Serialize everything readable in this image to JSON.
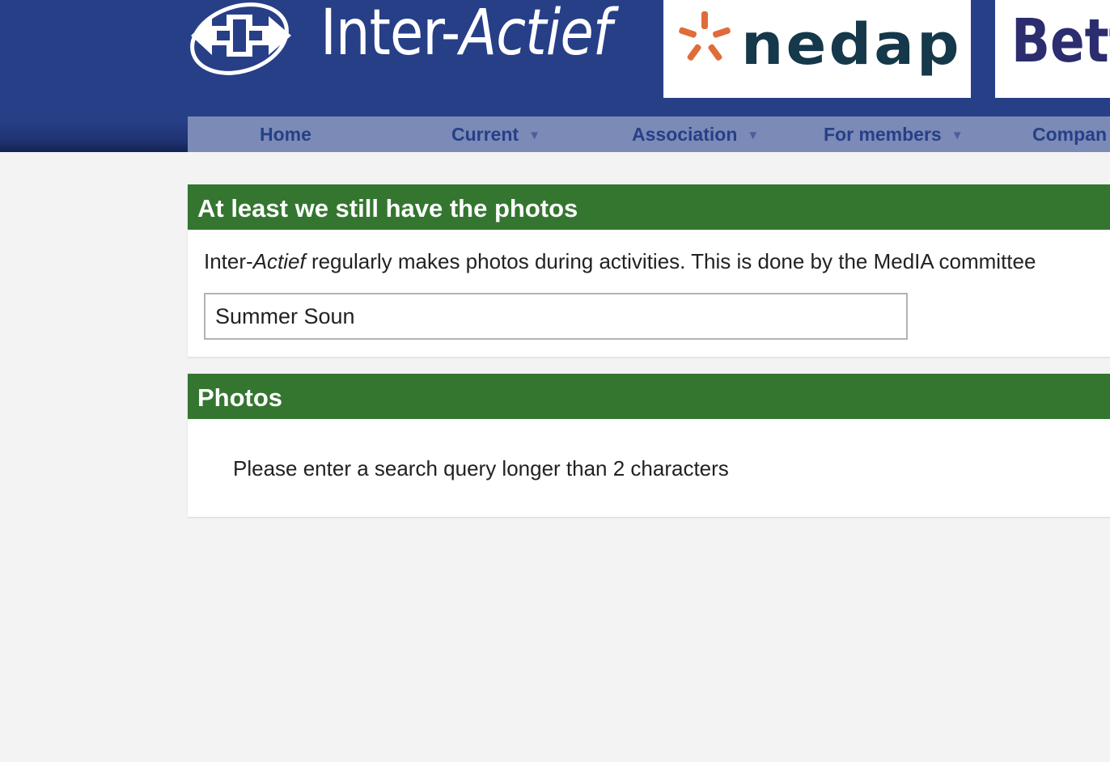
{
  "site": {
    "name_prefix": "Inter-",
    "name_italic": "Actief",
    "logo_icon": "inter-actief-logo-icon"
  },
  "sponsors": [
    {
      "name": "nedap",
      "icon": "nedap-star-icon",
      "color": "#15384a",
      "star_color": "#e06c3a"
    },
    {
      "name": "Bett",
      "color": "#2b2d6e"
    }
  ],
  "nav": {
    "items": [
      {
        "label": "Home",
        "has_dropdown": false
      },
      {
        "label": "Current",
        "has_dropdown": true
      },
      {
        "label": "Association",
        "has_dropdown": true
      },
      {
        "label": "For members",
        "has_dropdown": true
      },
      {
        "label": "Compan",
        "has_dropdown": false
      }
    ],
    "caret": "▼"
  },
  "photos_intro": {
    "title": "At least we still have the photos",
    "text_prefix": "Inter-",
    "text_italic": "Actief",
    "text_rest": " regularly makes photos during activities. This is done by the MedIA committee"
  },
  "search": {
    "value": "Summer Soun"
  },
  "results": {
    "title": "Photos",
    "message": "Please enter a search query longer than 2 characters"
  },
  "colors": {
    "header_blue": "#263f87",
    "nav_bg": "#7b8ab7",
    "panel_green": "#347630",
    "page_bg": "#f3f3f3"
  }
}
